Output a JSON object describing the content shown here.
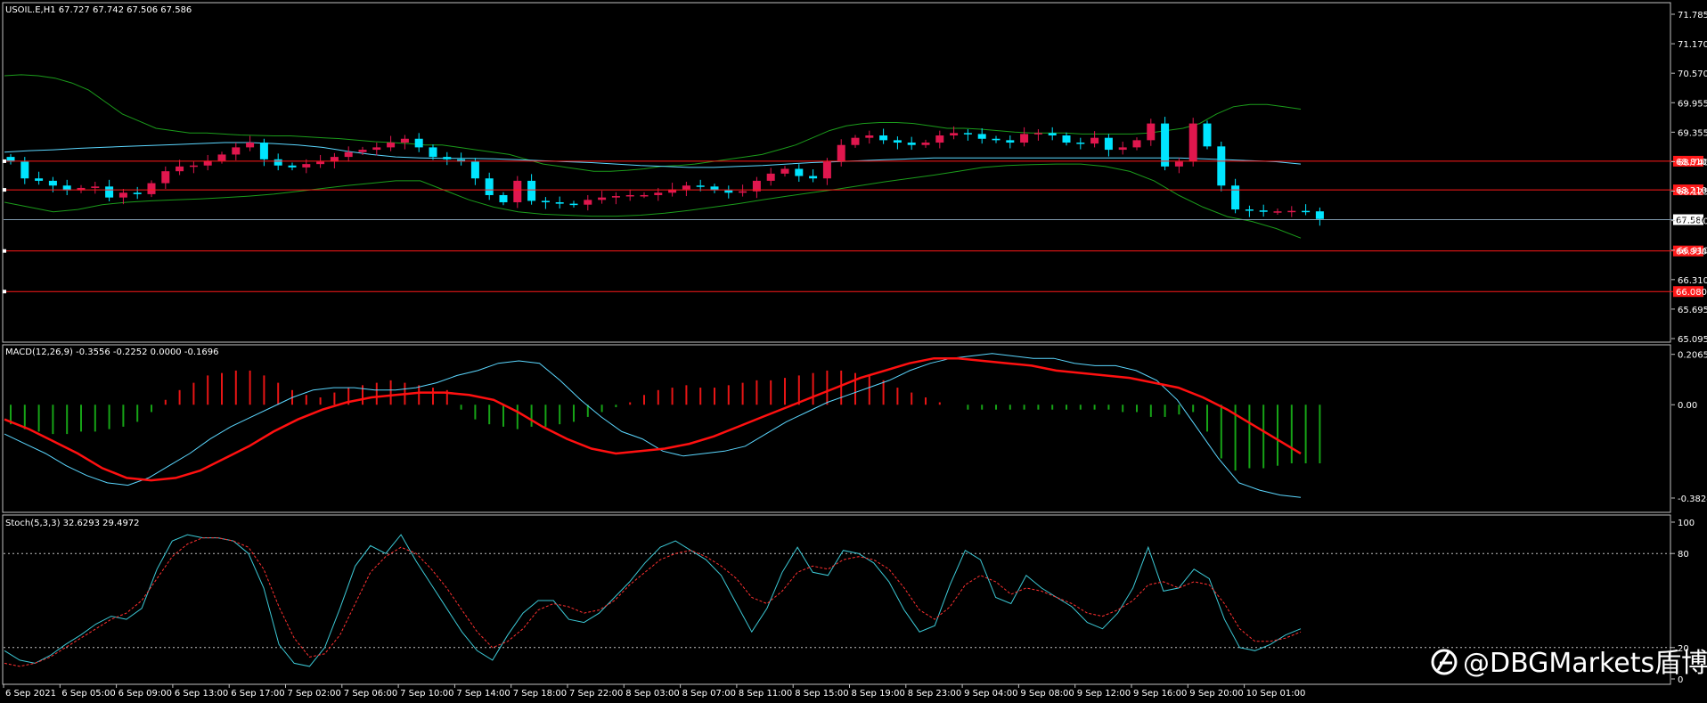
{
  "window": {
    "info": "USOIL.E,H1  67.727 67.742 67.506 67.586",
    "watermark": "@DBGMarkets盾博"
  },
  "colors": {
    "background": "#000000",
    "frame": "#c0c0c0",
    "bull": "#e0174e",
    "bear": "#00e5ff",
    "hline": "#ff1a1a",
    "bid_line": "#7d96aa",
    "bb": "#1b9c1b",
    "ma": "#5bd7ff",
    "ma2": "#ff6a00",
    "macd_pos": "#e81515",
    "macd_neg": "#16a316",
    "signal": "#ff1010",
    "stoch_main": "#3cc9d6",
    "stoch_signal": "#ff3030"
  },
  "chart_data": [
    {
      "type": "candlestick",
      "symbol": "USOIL.E",
      "timeframe": "H1",
      "ylim": [
        65.095,
        72.0
      ],
      "y_ticks": [
        "71.785",
        "71.170",
        "70.570",
        "69.955",
        "69.355",
        "68.740",
        "68.125",
        "67.510",
        "66.910",
        "66.310",
        "65.695",
        "65.095"
      ],
      "x_ticks": [
        "6 Sep 2021",
        "6 Sep 05:00",
        "6 Sep 09:00",
        "6 Sep 13:00",
        "6 Sep 17:00",
        "7 Sep 02:00",
        "7 Sep 06:00",
        "7 Sep 10:00",
        "7 Sep 14:00",
        "7 Sep 18:00",
        "7 Sep 22:00",
        "8 Sep 03:00",
        "8 Sep 07:00",
        "8 Sep 11:00",
        "8 Sep 15:00",
        "8 Sep 19:00",
        "8 Sep 23:00",
        "9 Sep 04:00",
        "9 Sep 08:00",
        "9 Sep 12:00",
        "9 Sep 16:00",
        "9 Sep 20:00",
        "10 Sep 01:00"
      ],
      "current_price": 67.586,
      "current_price_label": "67.586",
      "horizontal_levels": [
        {
          "value": 68.81,
          "label": "68.810"
        },
        {
          "value": 68.21,
          "label": "68.210"
        },
        {
          "value": 66.93,
          "label": "66.930"
        },
        {
          "value": 66.08,
          "label": "66.080"
        }
      ],
      "close": [
        68.8,
        68.45,
        68.4,
        68.3,
        68.2,
        68.25,
        68.28,
        68.05,
        68.15,
        68.12,
        68.35,
        68.6,
        68.7,
        68.72,
        68.82,
        68.95,
        69.1,
        69.2,
        68.85,
        68.72,
        68.68,
        68.75,
        68.8,
        68.9,
        69.0,
        69.05,
        69.1,
        69.2,
        69.28,
        69.1,
        68.9,
        68.85,
        68.8,
        68.45,
        68.1,
        67.95,
        68.4,
        67.98,
        67.95,
        67.92,
        67.9,
        68.0,
        68.05,
        68.08,
        68.1,
        68.1,
        68.15,
        68.22,
        68.3,
        68.28,
        68.2,
        68.15,
        68.18,
        68.4,
        68.55,
        68.65,
        68.5,
        68.45,
        68.8,
        69.15,
        69.3,
        69.35,
        69.25,
        69.2,
        69.15,
        69.2,
        69.35,
        69.4,
        69.38,
        69.28,
        69.25,
        69.2,
        69.38,
        69.4,
        69.35,
        69.2,
        69.18,
        69.3,
        69.05,
        69.1,
        69.25,
        69.6,
        68.7,
        68.8,
        69.6,
        69.12,
        68.3,
        67.8,
        67.78,
        67.75,
        67.76,
        67.77,
        67.76,
        67.6
      ],
      "open_offset_note": "",
      "bollinger": {
        "upper": [
          70.6,
          70.62,
          70.6,
          70.55,
          70.45,
          70.3,
          70.05,
          69.8,
          69.65,
          69.5,
          69.45,
          69.4,
          69.4,
          69.38,
          69.36,
          69.35,
          69.34,
          69.34,
          69.32,
          69.3,
          69.28,
          69.25,
          69.22,
          69.2,
          69.18,
          69.15,
          69.15,
          69.1,
          69.05,
          69.0,
          68.95,
          68.85,
          68.75,
          68.7,
          68.65,
          68.6,
          68.6,
          68.62,
          68.65,
          68.7,
          68.72,
          68.75,
          68.8,
          68.85,
          68.9,
          68.95,
          69.05,
          69.15,
          69.3,
          69.45,
          69.55,
          69.6,
          69.62,
          69.62,
          69.6,
          69.55,
          69.5,
          69.5,
          69.48,
          69.45,
          69.42,
          69.4,
          69.4,
          69.4,
          69.38,
          69.38,
          69.38,
          69.38,
          69.4,
          69.45,
          69.5,
          69.6,
          69.8,
          69.95,
          70.0,
          70.0,
          69.95,
          69.9
        ],
        "lower": [
          67.95,
          67.85,
          67.75,
          67.8,
          67.9,
          67.95,
          67.98,
          68.0,
          68.02,
          68.05,
          68.08,
          68.12,
          68.18,
          68.24,
          68.3,
          68.35,
          68.4,
          68.4,
          68.2,
          68.0,
          67.85,
          67.75,
          67.7,
          67.68,
          67.66,
          67.66,
          67.68,
          67.72,
          67.78,
          67.85,
          67.92,
          68.0,
          68.08,
          68.15,
          68.22,
          68.3,
          68.38,
          68.45,
          68.52,
          68.6,
          68.68,
          68.72,
          68.74,
          68.75,
          68.75,
          68.7,
          68.6,
          68.4,
          68.1,
          67.85,
          67.65,
          67.55,
          67.4,
          67.2
        ],
        "middle": [
          69.0,
          69.03,
          69.05,
          69.08,
          69.1,
          69.12,
          69.14,
          69.16,
          69.18,
          69.2,
          69.2,
          69.18,
          69.15,
          69.1,
          69.02,
          68.95,
          68.9,
          68.88,
          68.87,
          68.87,
          68.86,
          68.84,
          68.82,
          68.8,
          68.78,
          68.75,
          68.72,
          68.7,
          68.68,
          68.68,
          68.7,
          68.72,
          68.75,
          68.78,
          68.8,
          68.82,
          68.84,
          68.86,
          68.88,
          68.88,
          68.88,
          68.88,
          68.88,
          68.88,
          68.88,
          68.88,
          68.88,
          68.88,
          68.88,
          68.86,
          68.84,
          68.82,
          68.8,
          68.75
        ]
      }
    },
    {
      "type": "bar+line",
      "name": "MACD(12,26,9)",
      "label": "MACD(12,26,9) -0.3556 -0.2252 0.0000 -0.1696",
      "ylim": [
        -0.43,
        0.22
      ],
      "y_ticks": [
        "0.2065",
        "0.00",
        "-0.3824"
      ],
      "histogram": [
        -0.08,
        -0.1,
        -0.11,
        -0.12,
        -0.12,
        -0.11,
        -0.11,
        -0.1,
        -0.09,
        -0.07,
        -0.03,
        0.02,
        0.06,
        0.09,
        0.12,
        0.13,
        0.14,
        0.14,
        0.12,
        0.09,
        0.06,
        0.04,
        0.03,
        0.05,
        0.07,
        0.08,
        0.09,
        0.1,
        0.09,
        0.08,
        0.07,
        0.06,
        -0.02,
        -0.06,
        -0.08,
        -0.09,
        -0.1,
        -0.09,
        -0.09,
        -0.08,
        -0.07,
        -0.05,
        -0.03,
        -0.01,
        0.01,
        0.04,
        0.06,
        0.07,
        0.08,
        0.07,
        0.07,
        0.08,
        0.09,
        0.1,
        0.1,
        0.11,
        0.12,
        0.13,
        0.14,
        0.14,
        0.13,
        0.12,
        0.1,
        0.07,
        0.05,
        0.03,
        0.01,
        0.0,
        -0.02,
        -0.02,
        -0.02,
        -0.02,
        -0.02,
        -0.02,
        -0.02,
        -0.02,
        -0.02,
        -0.02,
        -0.02,
        -0.03,
        -0.03,
        -0.05,
        -0.05,
        -0.04,
        -0.03,
        -0.11,
        -0.22,
        -0.27,
        -0.26,
        -0.26,
        -0.25,
        -0.24,
        -0.24,
        -0.24
      ],
      "macd_main": [
        -0.12,
        -0.16,
        -0.2,
        -0.25,
        -0.29,
        -0.32,
        -0.33,
        -0.3,
        -0.25,
        -0.2,
        -0.14,
        -0.09,
        -0.05,
        -0.01,
        0.03,
        0.06,
        0.07,
        0.07,
        0.06,
        0.06,
        0.07,
        0.09,
        0.12,
        0.14,
        0.17,
        0.18,
        0.17,
        0.1,
        0.02,
        -0.05,
        -0.11,
        -0.14,
        -0.19,
        -0.21,
        -0.2,
        -0.19,
        -0.17,
        -0.12,
        -0.07,
        -0.03,
        0.01,
        0.04,
        0.07,
        0.1,
        0.14,
        0.17,
        0.19,
        0.2,
        0.21,
        0.2,
        0.19,
        0.19,
        0.17,
        0.16,
        0.16,
        0.14,
        0.1,
        0.02,
        -0.1,
        -0.22,
        -0.32,
        -0.35,
        -0.37,
        -0.38
      ],
      "signal": [
        -0.06,
        -0.1,
        -0.15,
        -0.2,
        -0.26,
        -0.3,
        -0.31,
        -0.3,
        -0.27,
        -0.22,
        -0.17,
        -0.11,
        -0.06,
        -0.02,
        0.01,
        0.03,
        0.04,
        0.05,
        0.05,
        0.04,
        0.02,
        -0.03,
        -0.09,
        -0.14,
        -0.18,
        -0.2,
        -0.19,
        -0.18,
        -0.16,
        -0.13,
        -0.09,
        -0.05,
        -0.01,
        0.03,
        0.07,
        0.11,
        0.14,
        0.17,
        0.19,
        0.19,
        0.18,
        0.17,
        0.16,
        0.14,
        0.13,
        0.12,
        0.11,
        0.09,
        0.07,
        0.03,
        -0.02,
        -0.08,
        -0.14,
        -0.2
      ]
    },
    {
      "type": "line",
      "name": "Stoch(5,3,3)",
      "label": "Stoch(5,3,3) 32.6293 29.4972",
      "ylim": [
        0,
        100
      ],
      "y_ticks": [
        "100",
        "80",
        "20",
        "0"
      ],
      "levels": [
        80,
        20
      ],
      "main": [
        18,
        12,
        10,
        15,
        22,
        28,
        35,
        40,
        38,
        45,
        70,
        88,
        92,
        90,
        90,
        88,
        80,
        58,
        22,
        10,
        8,
        20,
        45,
        72,
        85,
        80,
        92,
        75,
        60,
        45,
        30,
        18,
        12,
        28,
        42,
        50,
        50,
        38,
        36,
        42,
        52,
        62,
        74,
        84,
        88,
        82,
        76,
        66,
        48,
        30,
        45,
        68,
        84,
        68,
        66,
        82,
        80,
        74,
        62,
        44,
        30,
        34,
        60,
        82,
        76,
        52,
        48,
        66,
        58,
        52,
        46,
        36,
        32,
        42,
        58,
        84,
        56,
        58,
        70,
        64,
        38,
        20,
        18,
        22,
        28,
        32
      ],
      "signal": [
        10,
        8,
        10,
        14,
        20,
        26,
        32,
        38,
        42,
        50,
        64,
        78,
        86,
        90,
        90,
        88,
        84,
        70,
        46,
        26,
        14,
        16,
        28,
        48,
        68,
        78,
        84,
        80,
        70,
        58,
        44,
        30,
        20,
        24,
        32,
        44,
        48,
        46,
        42,
        44,
        50,
        60,
        68,
        76,
        80,
        82,
        78,
        72,
        64,
        52,
        48,
        56,
        68,
        72,
        70,
        76,
        78,
        76,
        70,
        58,
        44,
        38,
        46,
        60,
        66,
        62,
        54,
        58,
        56,
        52,
        48,
        42,
        40,
        44,
        50,
        60,
        62,
        58,
        62,
        60,
        48,
        32,
        24,
        24,
        26,
        30
      ]
    }
  ]
}
